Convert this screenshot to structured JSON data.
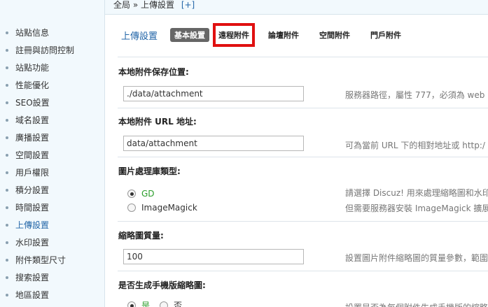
{
  "breadcrumb": {
    "text": "全局 » 上傳設置",
    "add": "[+]"
  },
  "sidebar": {
    "items": [
      {
        "label": "站點信息"
      },
      {
        "label": "註冊與訪問控制"
      },
      {
        "label": "站點功能"
      },
      {
        "label": "性能優化"
      },
      {
        "label": "SEO設置"
      },
      {
        "label": "域名設置"
      },
      {
        "label": "廣播設置"
      },
      {
        "label": "空間設置"
      },
      {
        "label": "用戶權限"
      },
      {
        "label": "積分設置"
      },
      {
        "label": "時間設置"
      },
      {
        "label": "上傳設置"
      },
      {
        "label": "水印設置"
      },
      {
        "label": "附件類型尺寸"
      },
      {
        "label": "搜索設置"
      },
      {
        "label": "地區設置"
      }
    ],
    "active_item": "上傳設置"
  },
  "page": {
    "title": "上傳設置",
    "tabs": [
      {
        "label": "基本設置",
        "state": "current"
      },
      {
        "label": "遠程附件",
        "state": "highlighted"
      },
      {
        "label": "論壇附件",
        "state": "normal"
      },
      {
        "label": "空間附件",
        "state": "normal"
      },
      {
        "label": "門戶附件",
        "state": "normal"
      }
    ]
  },
  "form": {
    "local_path": {
      "label": "本地附件保存位置:",
      "value": "./data/attachment",
      "hint": "服務器路徑，屬性 777，必須為 web"
    },
    "local_url": {
      "label": "本地附件 URL 地址:",
      "value": "data/attachment",
      "hint": "可為當前 URL 下的相對地址或 http:/"
    },
    "image_lib": {
      "label": "圖片處理庫類型:",
      "options": [
        "GD",
        "ImageMagick"
      ],
      "selected": "GD",
      "hint_1": "請選擇 Discuz! 用來處理縮略圖和水印",
      "hint_2": "但需要服務器安裝 ImageMagick 擴展"
    },
    "thumb_quality": {
      "label": "縮略圖質量:",
      "value": "100",
      "hint": "設置圖片附件縮略圖的質量參數，範圍"
    },
    "mobile_thumb": {
      "label": "是否生成手機版縮略圖:",
      "yes": "是",
      "no": "否",
      "selected": "是",
      "hint": "設置是否為每個附件生成手機版的縮略"
    }
  },
  "colors": {
    "sidebar_bg": "#f2f9fd",
    "link_blue": "#2366a8",
    "highlight_red": "#e01010",
    "green": "#2a9d2a"
  }
}
